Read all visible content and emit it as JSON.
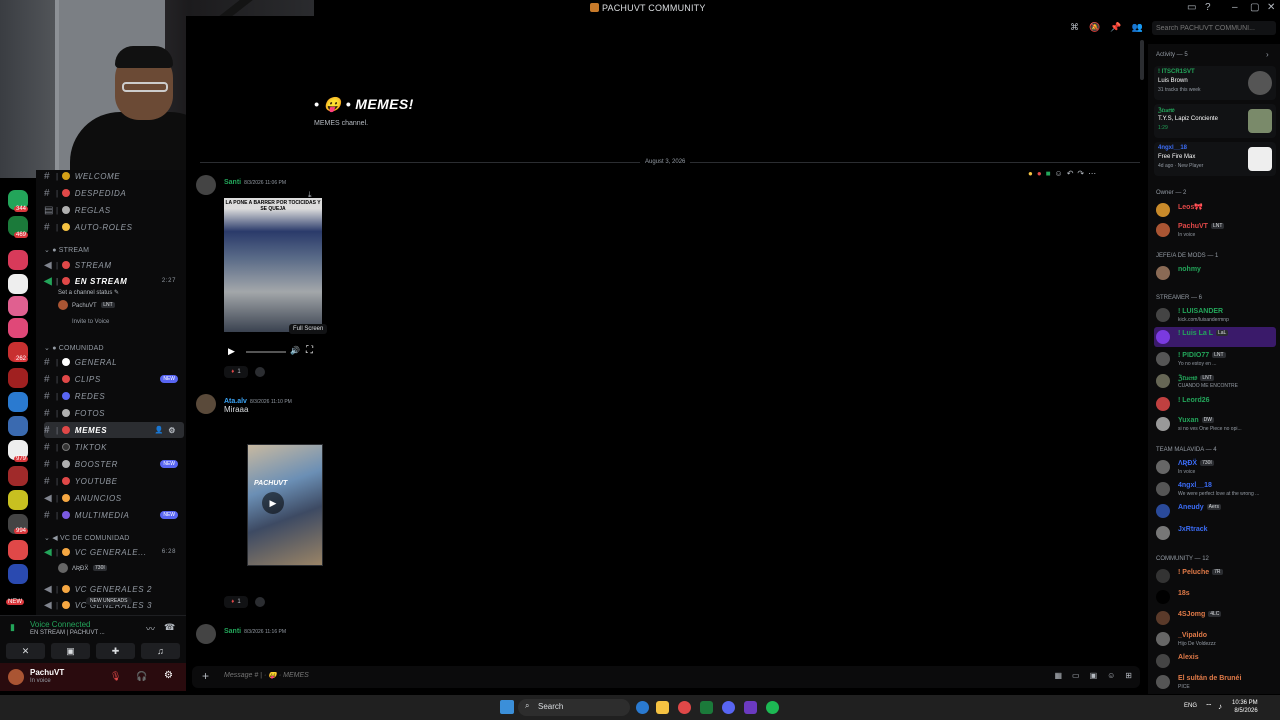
{
  "window": {
    "title": "PACHUVT COMMUNITY"
  },
  "toolbar": {
    "search_placeholder": "Search PACHUVT COMMUNI..."
  },
  "channels": {
    "items": [
      {
        "name": "WELCOME",
        "dot": "#d4a017"
      },
      {
        "name": "DESPEDIDA",
        "dot": "#e04848"
      },
      {
        "name": "REGLAS",
        "dot": "#b0b0b0"
      },
      {
        "name": "AUTO-ROLES",
        "dot": "#f5c242"
      }
    ],
    "stream_category": "STREAM",
    "stream_items": [
      {
        "name": "STREAM",
        "dot": "#e04848"
      },
      {
        "name": "EN STREAM",
        "dot": "#e04848",
        "time": "2:27"
      }
    ],
    "stream_status": "Set a channel status",
    "stream_user": "PachuVT",
    "stream_user_tag": "LNT",
    "invite_label": "Invite to Voice",
    "comunidad_category": "COMUNIDAD",
    "comunidad_items": [
      {
        "name": "GENERAL",
        "dot": "#ffffff",
        "badge": ""
      },
      {
        "name": "CLIPS",
        "dot": "#e04848",
        "badge": "NEW"
      },
      {
        "name": "REDES",
        "dot": "#5865f2",
        "badge": ""
      },
      {
        "name": "FOTOS",
        "dot": "#b0b0b0",
        "badge": ""
      },
      {
        "name": "MEMES",
        "dot": "#e04848",
        "badge": ""
      },
      {
        "name": "TIKTOK",
        "dot": "#111111",
        "badge": ""
      },
      {
        "name": "BOOSTER",
        "dot": "#b0b0b0",
        "badge": "NEW"
      },
      {
        "name": "YOUTUBE",
        "dot": "#e04848",
        "badge": ""
      },
      {
        "name": "ANUNCIOS",
        "dot": "#f5a742",
        "badge": ""
      },
      {
        "name": "MULTIMEDIA",
        "dot": "#7a5ae0",
        "badge": "NEW"
      }
    ],
    "vc_category": "VC DE COMUNIDAD",
    "vc_items": [
      {
        "name": "VC GENERALE...",
        "time": "6:28"
      },
      {
        "name": "VC GENERALES 2",
        "time": ""
      },
      {
        "name": "VC GENERALES 3",
        "time": ""
      }
    ],
    "vc_user": "ɅƦĐẌ",
    "vc_user_tag": "730I",
    "new_unreads": "NEW UNREADS"
  },
  "voice": {
    "title": "Voice Connected",
    "subtitle": "EN STREAM | PACHUVT ..."
  },
  "user": {
    "name": "PachuVT",
    "status": "In voice"
  },
  "rail_badges": [
    "344",
    "469",
    "262",
    "979",
    "994",
    "NEW"
  ],
  "channel_header": {
    "title": "• 😛 • MEMES!",
    "desc": "MEMES channel."
  },
  "date_divider": "August 3, 2026",
  "messages": [
    {
      "author": "Santi",
      "time": "8/3/2026 11:06 PM",
      "color": "#23a55a",
      "caption": "LA PONE A BARRER POR TOCICIDAS Y SE QUEJA",
      "reaction_count": "1"
    },
    {
      "author": "Ata.alv",
      "time": "8/3/2026 11:10 PM",
      "color": "#3ba4f5",
      "text": "Miraaa",
      "watermark": "PACHUVT",
      "reaction_count": "1"
    },
    {
      "author": "Santi",
      "time": "8/3/2026 11:16 PM",
      "color": "#23a55a"
    }
  ],
  "video": {
    "tooltip": "Full Screen"
  },
  "composer": {
    "placeholder": "Message # | · 😛 · MEMES"
  },
  "members": {
    "activity_header": "Activity — 5",
    "activity": [
      {
        "title": "! ITSCR1SVT",
        "line2": "Luis Brown",
        "line3": "31 tracks this week",
        "color": "#23a55a",
        "thumb": "#555"
      },
      {
        "title": "ℨ𝔯𝔲𝔢𝔫𝔬",
        "line2": "T.Y.S, Lapiz Conciente",
        "line3": "1:29",
        "color": "#23a55a",
        "thumb": "#7a8a6a"
      },
      {
        "title": "4ngxl__18",
        "line2": "Free Fire Max",
        "line3": "4d ago · New Player",
        "color": "#3b6cf5",
        "thumb": "#eeeeee"
      }
    ],
    "groups": [
      {
        "header": "Owner — 2",
        "rows": [
          {
            "name": "Leos🎀",
            "sub": "",
            "color": "#e04848",
            "av": "#c98a2a"
          },
          {
            "name": "PachuVT",
            "sub": "In voice",
            "color": "#e04848",
            "av": "#aa5533",
            "tag": "LNT"
          }
        ]
      },
      {
        "header": "JEFE/A DE MODS — 1",
        "rows": [
          {
            "name": "nohmy",
            "sub": "",
            "color": "#23a55a",
            "av": "#8a6a55"
          }
        ]
      },
      {
        "header": "STREAMER — 6",
        "rows": [
          {
            "name": "! LUISANDER",
            "sub": "kick.com/luisandermnp",
            "color": "#23a55a",
            "av": "#444"
          },
          {
            "name": "! Luis La L",
            "sub": "",
            "color": "#23a55a",
            "av": "#7a3ae0",
            "tag": "LaL"
          },
          {
            "name": "! PIDIO77",
            "sub": "Yo no estoy en ...",
            "color": "#23a55a",
            "av": "#555",
            "tag": "LNT"
          },
          {
            "name": "ℨ𝔯𝔲𝔢𝔫𝔬",
            "sub": "CUANDO ME ENCONTRE",
            "color": "#23a55a",
            "av": "#665",
            "tag": "LNT"
          },
          {
            "name": "! Leord26",
            "sub": "",
            "color": "#23a55a",
            "av": "#c04040"
          },
          {
            "name": "Yuxan",
            "sub": "si no ves One Piece no opi...",
            "color": "#23a55a",
            "av": "#999",
            "tag": "DW"
          }
        ]
      },
      {
        "header": "TEAM MALAVIDA — 4",
        "rows": [
          {
            "name": "ɅƦĐẌ",
            "sub": "In voice",
            "color": "#3b6cf5",
            "av": "#666",
            "tag": "730I"
          },
          {
            "name": "4ngxl__18",
            "sub": "We were perfect love at the wrong ...",
            "color": "#3b6cf5",
            "av": "#555"
          },
          {
            "name": "Aneudy",
            "sub": "",
            "color": "#3b6cf5",
            "av": "#2a4a9a",
            "tag": "Aers"
          },
          {
            "name": "JxRtrack",
            "sub": "",
            "color": "#3b6cf5",
            "av": "#777"
          }
        ]
      },
      {
        "header": "COMMUNITY — 12",
        "rows": [
          {
            "name": "! Peluche",
            "sub": "",
            "color": "#e07a48",
            "av": "#333",
            "tag": "7R"
          },
          {
            "name": "18s",
            "sub": "",
            "color": "#e07a48",
            "av": "#000"
          },
          {
            "name": "4SJomg",
            "sub": "",
            "color": "#e07a48",
            "av": "#5a3a2a",
            "tag": "4LC"
          },
          {
            "name": "_Vipaldo",
            "sub": "Hijo De Voldezzz",
            "color": "#e07a48",
            "av": "#666"
          },
          {
            "name": "Alexis",
            "sub": "",
            "color": "#e07a48",
            "av": "#444"
          },
          {
            "name": "El sultán de Brunéi",
            "sub": "PICE",
            "color": "#e07a48",
            "av": "#555"
          }
        ]
      }
    ]
  },
  "taskbar": {
    "search": "Search",
    "lang": "ENG",
    "time": "10:36 PM",
    "date": "8/5/2026"
  }
}
